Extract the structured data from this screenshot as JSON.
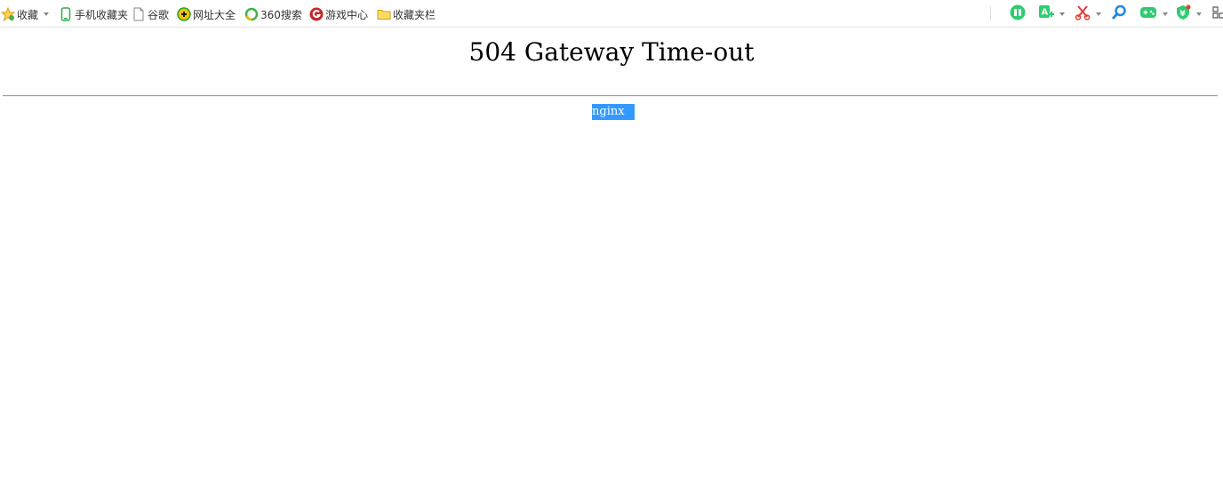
{
  "bookmarks_bar": {
    "favorites_label": "收藏",
    "items": [
      {
        "label": "手机收藏夹",
        "icon": "phone-icon"
      },
      {
        "label": "谷歌",
        "icon": "page-icon"
      },
      {
        "label": "网址大全",
        "icon": "site-directory-icon"
      },
      {
        "label": "360搜索",
        "icon": "360-search-icon"
      },
      {
        "label": "游戏中心",
        "icon": "game-center-icon"
      },
      {
        "label": "收藏夹栏",
        "icon": "folder-icon"
      }
    ],
    "extensions": [
      "ebook-icon",
      "translate-icon",
      "scissors-icon",
      "search-icon",
      "gamepad-icon",
      "shield-yuan-icon",
      "apps-grid-icon"
    ]
  },
  "page": {
    "title": "504 Gateway Time-out",
    "server": "nginx"
  },
  "colors": {
    "selection": "#3399ff",
    "green_accent": "#2ecc71",
    "red_accent": "#e53935",
    "blue_accent": "#1e88e5"
  }
}
